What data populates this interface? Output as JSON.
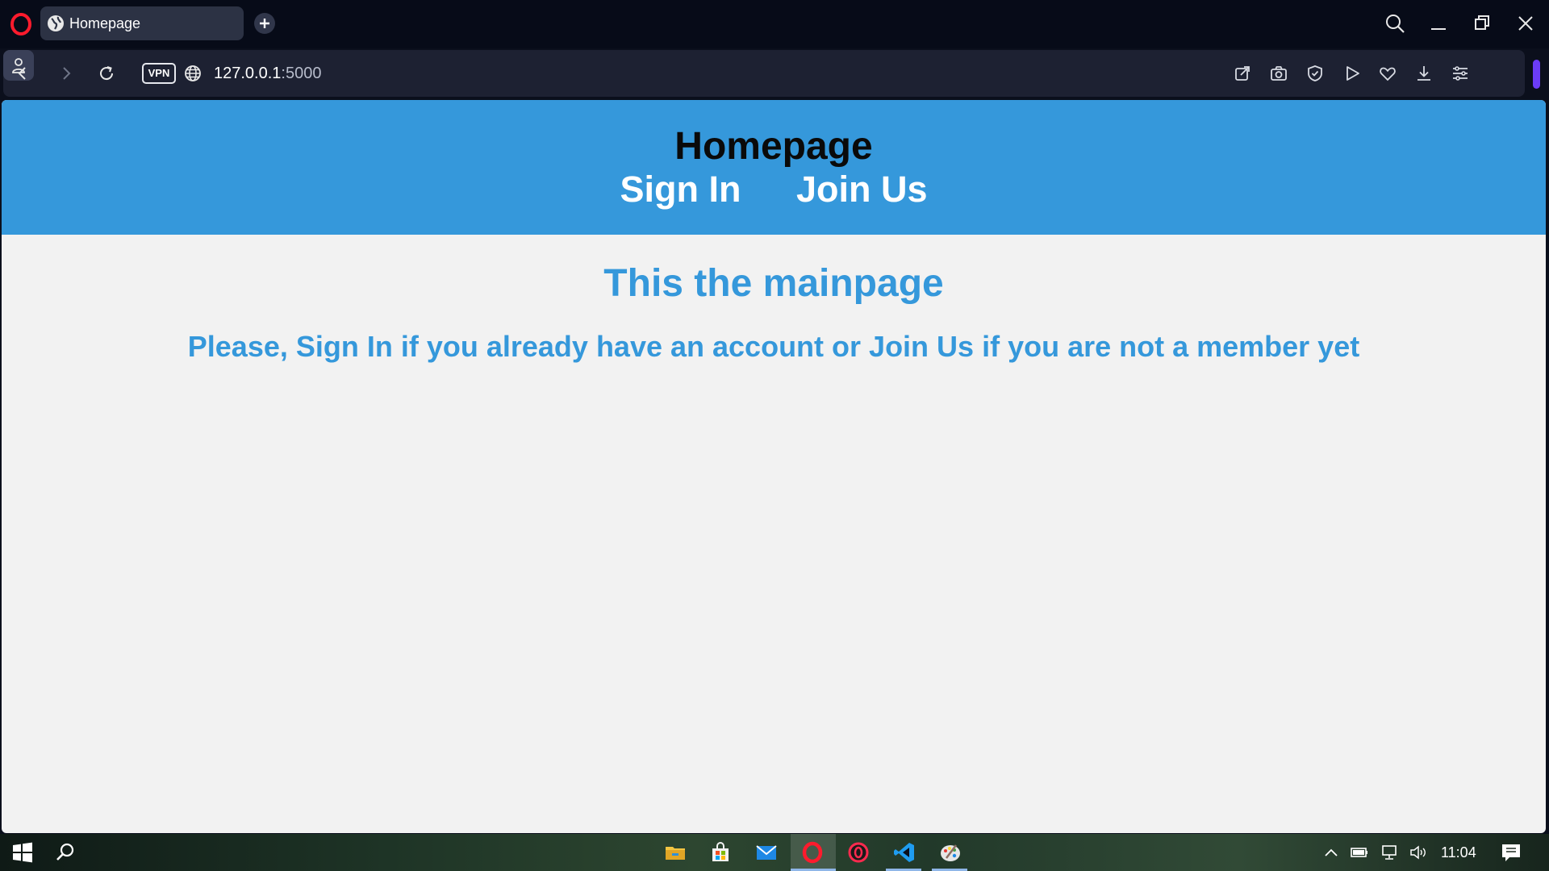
{
  "browser": {
    "tab_title": "Homepage",
    "url_host": "127.0.0.1",
    "url_port": ":5000",
    "vpn_label": "VPN",
    "accent_color": "#6b3cf6"
  },
  "page": {
    "header_title": "Homepage",
    "nav": [
      {
        "label": "Sign In"
      },
      {
        "label": "Join Us"
      }
    ],
    "heading": "This the mainpage",
    "message": "Please, Sign In if you already have an account or Join Us if you are not a member yet",
    "primary_color": "#3598db"
  },
  "taskbar": {
    "clock": "11:04",
    "apps": [
      "file-explorer-icon",
      "store-icon",
      "mail-icon",
      "opera-icon",
      "opera-gx-icon",
      "vscode-icon",
      "paint-icon"
    ]
  }
}
